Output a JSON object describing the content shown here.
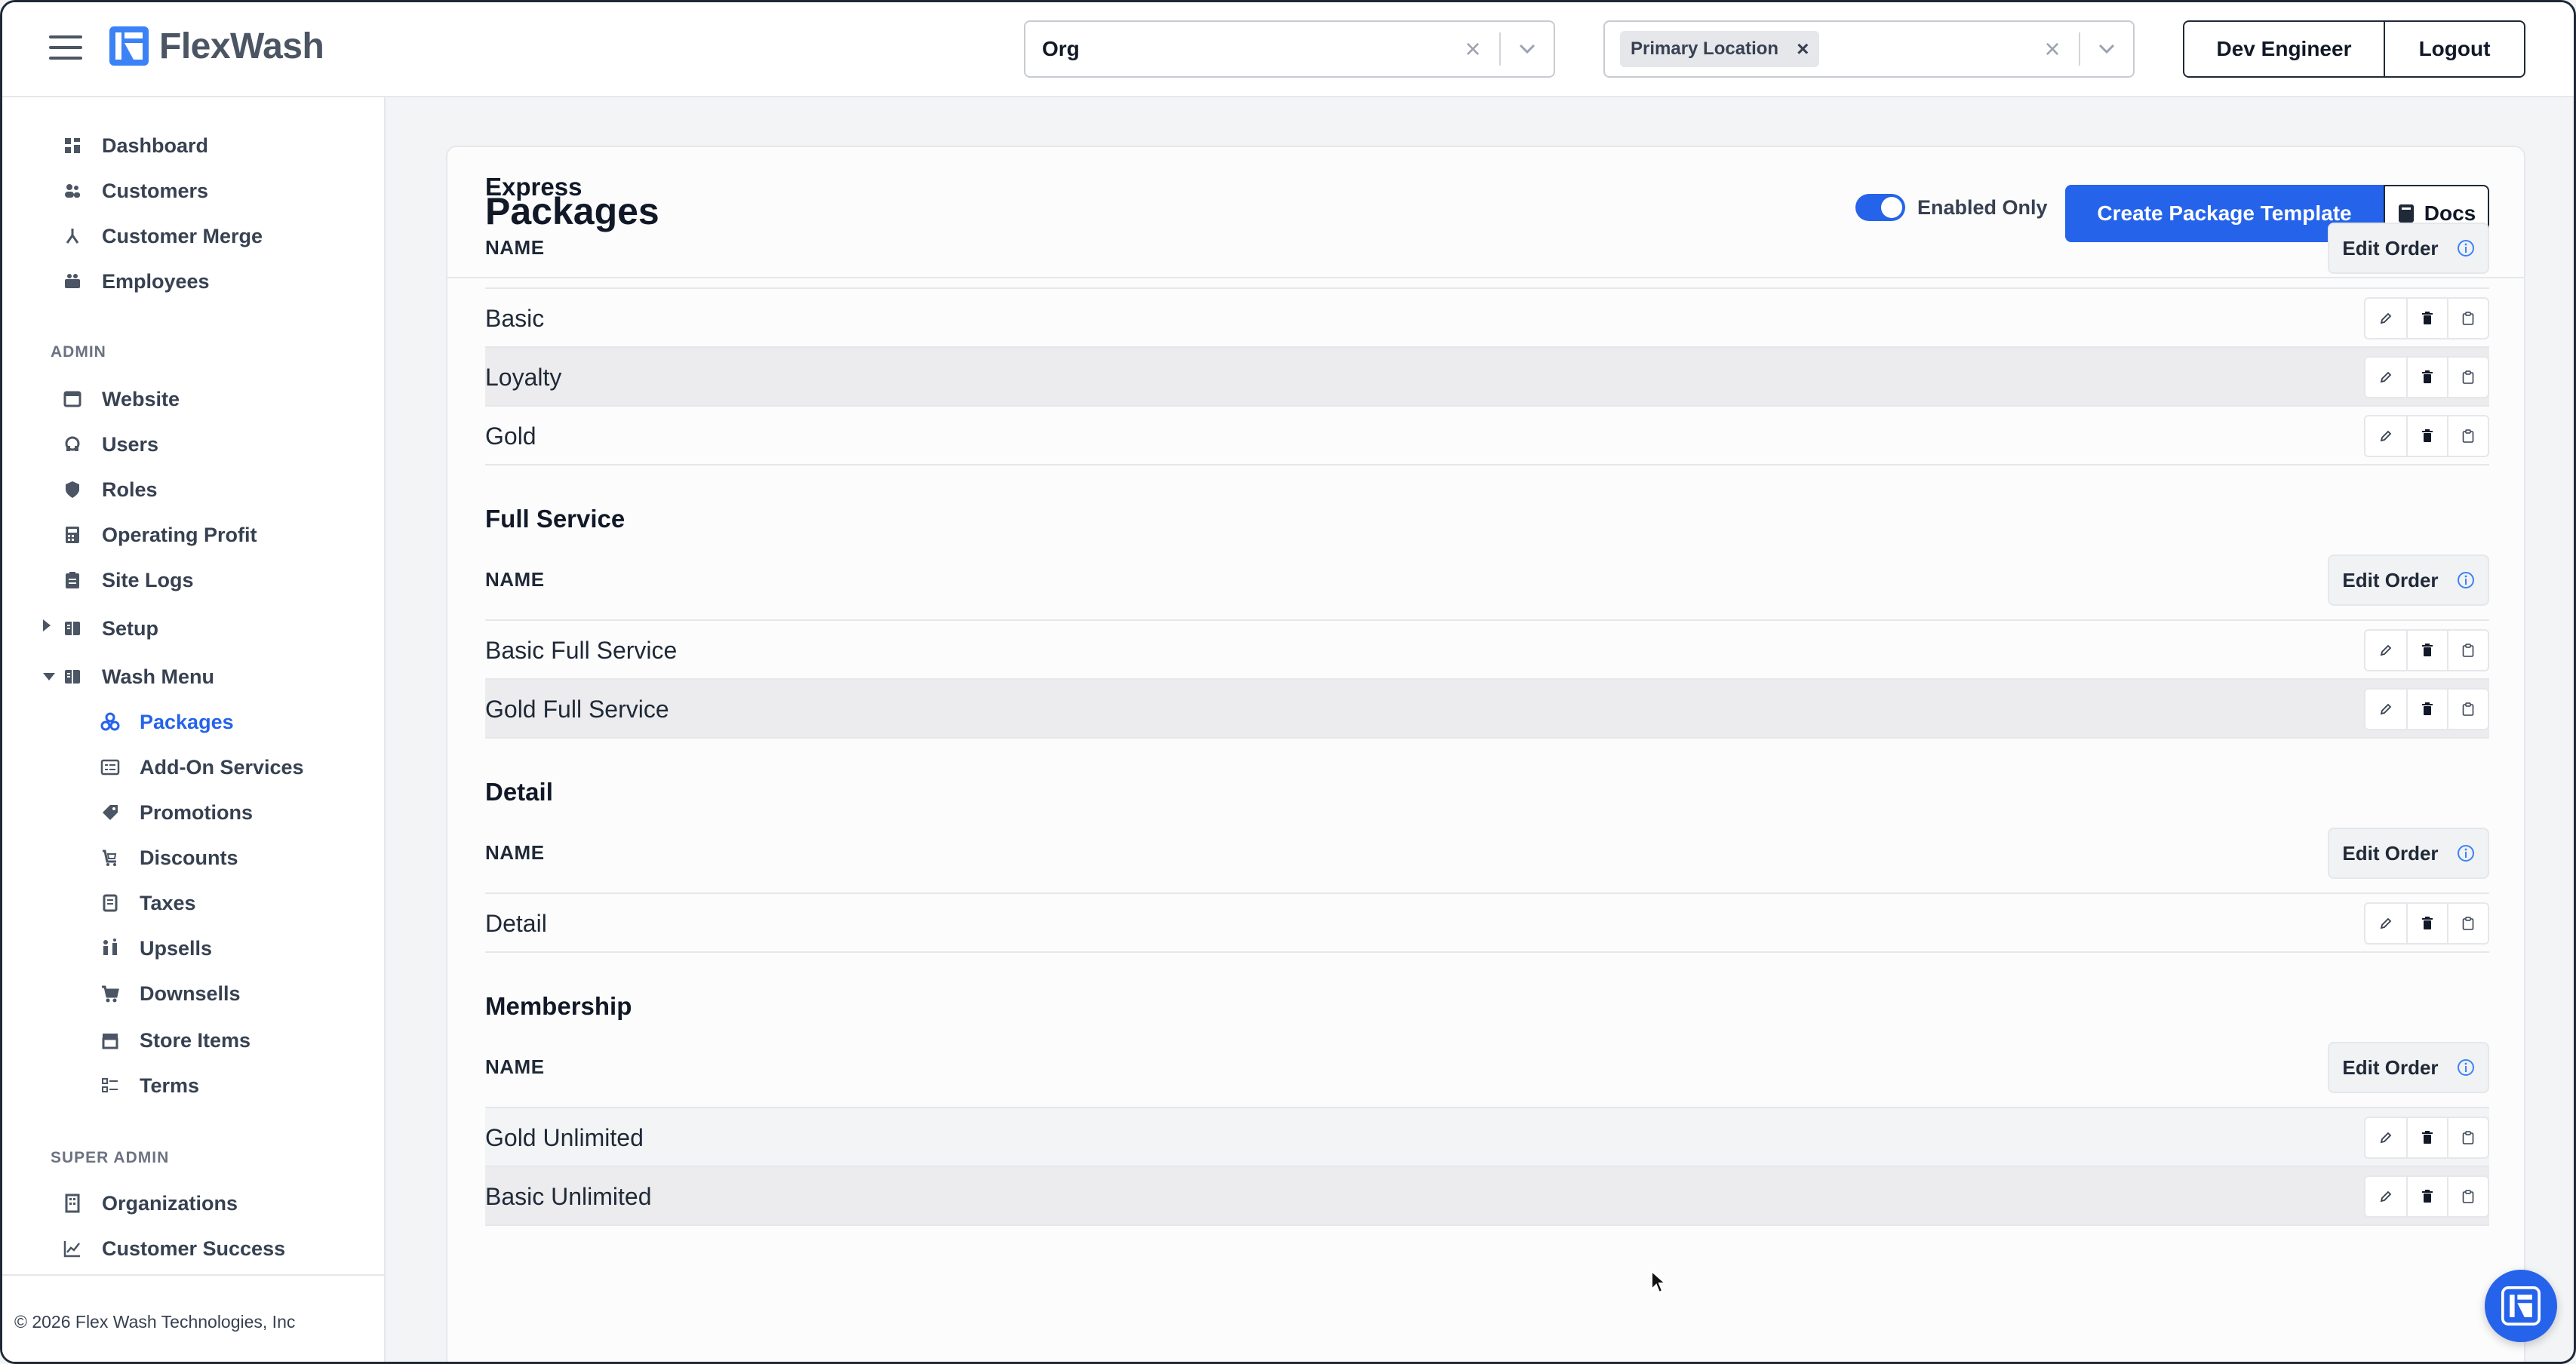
{
  "app": {
    "name": "FlexWash"
  },
  "header": {
    "org_select": {
      "value": "Org"
    },
    "location_select": {
      "chip": "Primary Location"
    },
    "user_button": "Dev Engineer",
    "logout_button": "Logout"
  },
  "sidebar": {
    "main": [
      {
        "label": "Dashboard",
        "icon": "dashboard-icon"
      },
      {
        "label": "Customers",
        "icon": "customers-icon"
      },
      {
        "label": "Customer Merge",
        "icon": "merge-icon"
      },
      {
        "label": "Employees",
        "icon": "employees-icon"
      }
    ],
    "admin_label": "ADMIN",
    "admin": [
      {
        "label": "Website",
        "icon": "website-icon"
      },
      {
        "label": "Users",
        "icon": "users-icon"
      },
      {
        "label": "Roles",
        "icon": "shield-icon"
      },
      {
        "label": "Operating Profit",
        "icon": "calculator-icon"
      },
      {
        "label": "Site Logs",
        "icon": "clipboard-icon"
      },
      {
        "label": "Setup",
        "icon": "book-icon"
      },
      {
        "label": "Wash Menu",
        "icon": "book-icon"
      }
    ],
    "wash_menu": [
      {
        "label": "Packages",
        "icon": "packages-icon"
      },
      {
        "label": "Add-On Services",
        "icon": "addon-icon"
      },
      {
        "label": "Promotions",
        "icon": "tag-icon"
      },
      {
        "label": "Discounts",
        "icon": "discount-icon"
      },
      {
        "label": "Taxes",
        "icon": "tax-icon"
      },
      {
        "label": "Upsells",
        "icon": "upsell-icon"
      },
      {
        "label": "Downsells",
        "icon": "cart-icon"
      },
      {
        "label": "Store Items",
        "icon": "store-icon"
      },
      {
        "label": "Terms",
        "icon": "terms-icon"
      }
    ],
    "super_admin_label": "SUPER ADMIN",
    "super_admin": [
      {
        "label": "Organizations",
        "icon": "building-icon"
      },
      {
        "label": "Customer Success",
        "icon": "chart-icon"
      }
    ],
    "footer": "© 2026 Flex Wash Technologies, Inc"
  },
  "main": {
    "title": "Packages",
    "enabled_only_label": "Enabled Only",
    "enabled_only": true,
    "create_button": "Create Package Template",
    "docs_button": "Docs",
    "column_header": "NAME",
    "edit_order_label": "Edit Order",
    "groups": [
      {
        "title": "Express",
        "rows": [
          "Basic",
          "Loyalty",
          "Gold"
        ]
      },
      {
        "title": "Full Service",
        "rows": [
          "Basic Full Service",
          "Gold Full Service"
        ]
      },
      {
        "title": "Detail",
        "rows": [
          "Detail"
        ]
      },
      {
        "title": "Membership",
        "rows": [
          "Gold Unlimited",
          "Basic Unlimited"
        ]
      }
    ]
  },
  "colors": {
    "accent": "#2563eb",
    "text": "#111827",
    "muted": "#6b7280"
  }
}
